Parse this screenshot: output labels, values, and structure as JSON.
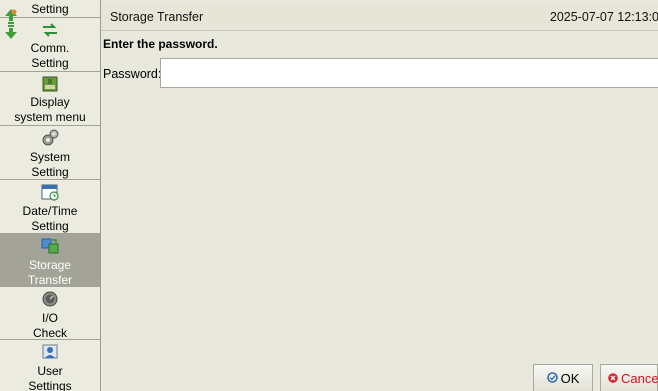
{
  "sidebar": {
    "items": [
      {
        "label": "Setting",
        "icon": "setting-icon",
        "selected": false
      },
      {
        "label": "Comm.\nSetting",
        "icon": "comm-arrows-icon",
        "selected": false
      },
      {
        "label": "Display\nsystem menu",
        "icon": "display-menu-icon",
        "selected": false
      },
      {
        "label": "System\nSetting",
        "icon": "gears-icon",
        "selected": false
      },
      {
        "label": "Date/Time\nSetting",
        "icon": "calendar-clock-icon",
        "selected": false
      },
      {
        "label": "Storage\nTransfer",
        "icon": "storage-transfer-icon",
        "selected": true
      },
      {
        "label": "I/O\nCheck",
        "icon": "io-meter-icon",
        "selected": false
      },
      {
        "label": "User\nSettings",
        "icon": "user-icon",
        "selected": false
      }
    ],
    "scroll_icon": "scroll-up-down-icon"
  },
  "header": {
    "title": "Storage Transfer",
    "datetime": "2025-07-07 12:13:0"
  },
  "main": {
    "prompt": "Enter the password.",
    "password_label": "Password:",
    "password_value": "",
    "password_placeholder": ""
  },
  "buttons": {
    "ok_label": "OK",
    "cancel_label": "Cancel",
    "ok_icon": "ok-check-icon",
    "cancel_icon": "cancel-x-icon"
  },
  "colors": {
    "background": "#e9e8dc",
    "selected_item": "#a4a398",
    "cancel_text": "#c8161d",
    "ok_icon": "#2f6fb7"
  }
}
